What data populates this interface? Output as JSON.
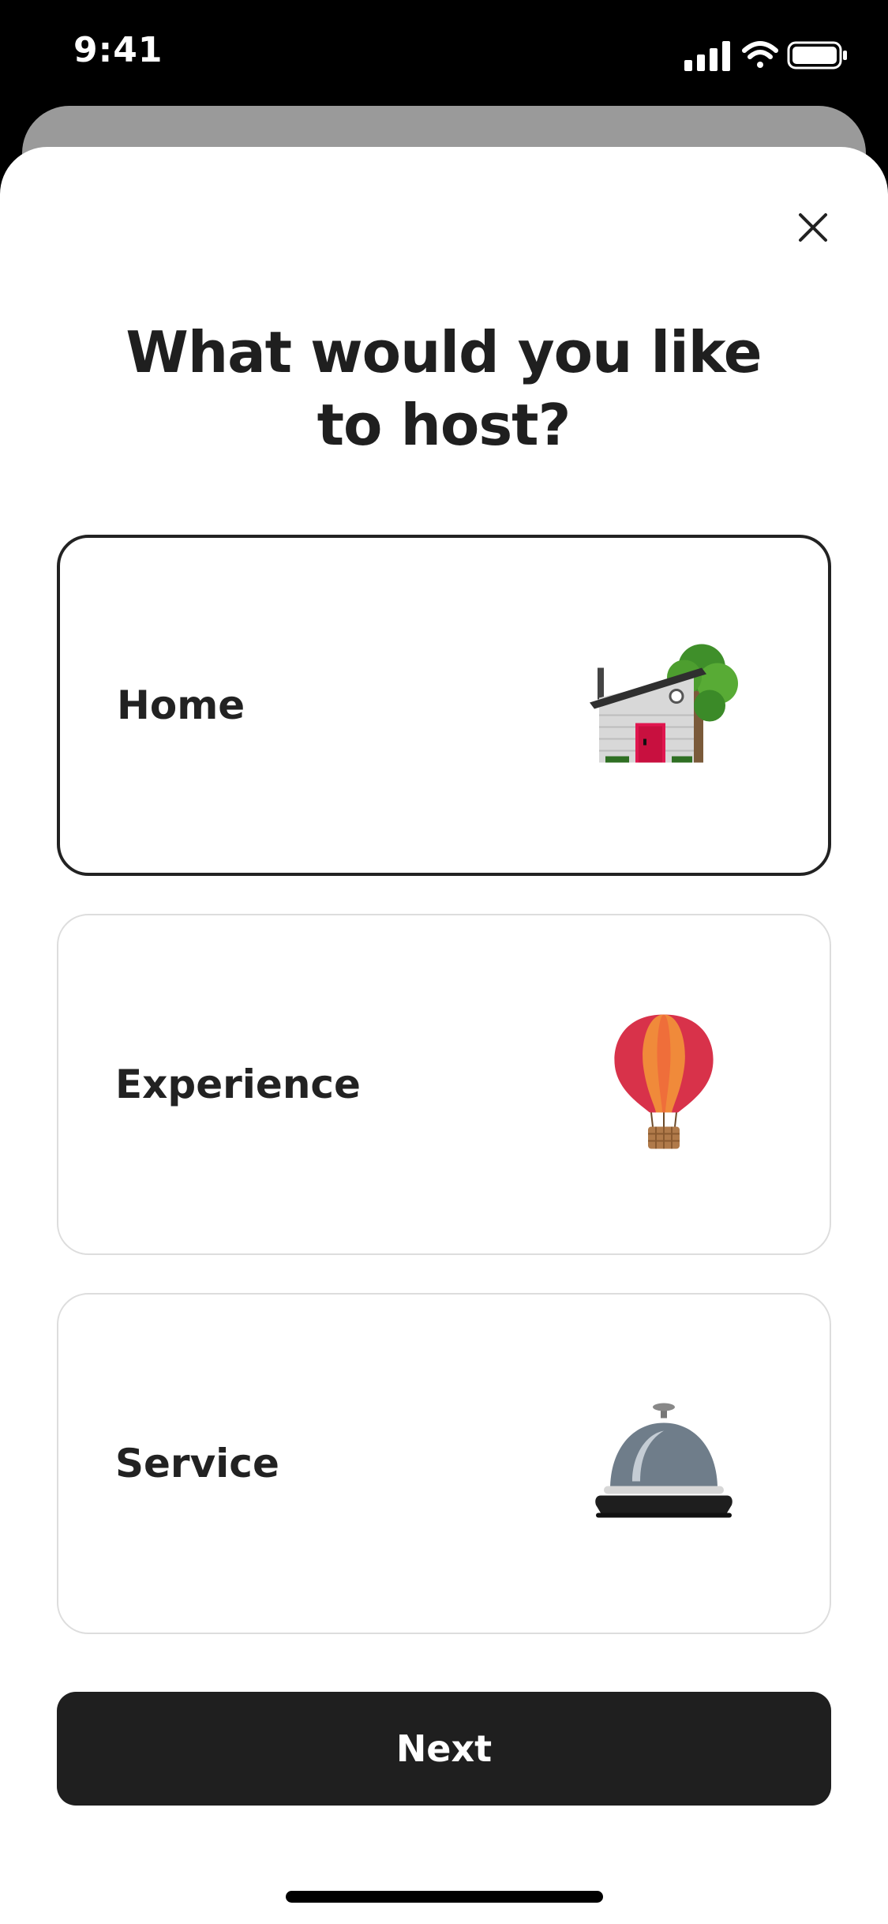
{
  "status_bar": {
    "time": "9:41",
    "signal_icon": "cellular-signal-icon",
    "wifi_icon": "wifi-icon",
    "battery_icon": "battery-icon"
  },
  "modal": {
    "close_icon": "close-icon",
    "title": "What would you like\nto host?"
  },
  "options": [
    {
      "label": "Home",
      "icon": "house-icon",
      "selected": true
    },
    {
      "label": "Experience",
      "icon": "hot-air-balloon-icon",
      "selected": false
    },
    {
      "label": "Service",
      "icon": "service-bell-icon",
      "selected": false
    }
  ],
  "footer": {
    "next_label": "Next"
  },
  "colors": {
    "selected_border": "#222222",
    "unselected_border": "#dddddd",
    "button_bg": "#1f1f1f",
    "door": "#e0164f"
  }
}
